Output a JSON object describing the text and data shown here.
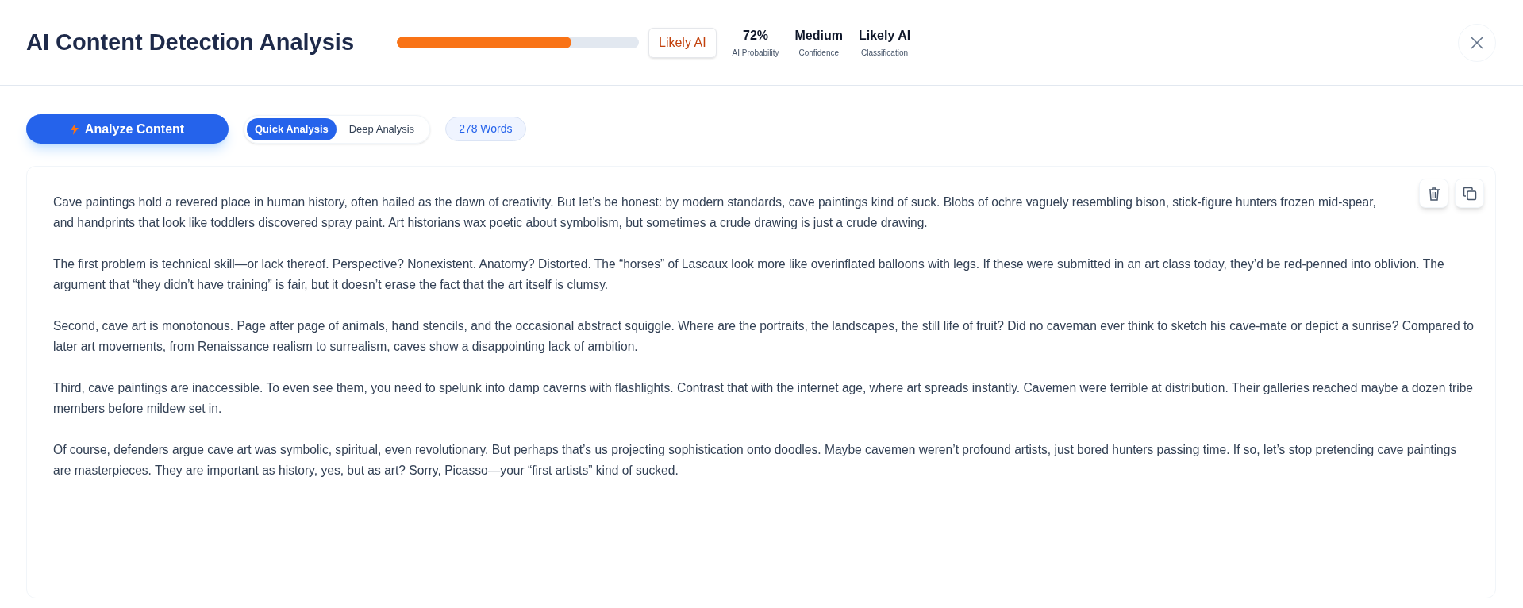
{
  "header": {
    "title": "AI Content Detection Analysis",
    "probability_bar": {
      "level": 0.72
    },
    "verdict_badge": "Likely AI",
    "stats": [
      {
        "value": "72%",
        "label": "AI Probability"
      },
      {
        "value": "Medium",
        "label": "Confidence"
      },
      {
        "value": "Likely AI",
        "label": "Classification"
      }
    ]
  },
  "toolbar": {
    "analyze_button": "Analyze Content",
    "modes": [
      {
        "label": "Quick Analysis",
        "selected": true
      },
      {
        "label": "Deep Analysis",
        "selected": false
      }
    ],
    "word_count": "278 Words"
  },
  "content": {
    "paragraphs": [
      "Cave paintings hold a revered place in human history, often hailed as the dawn of creativity. But let’s be honest: by modern standards, cave paintings kind of suck. Blobs of ochre vaguely resembling bison, stick-figure hunters frozen mid-spear, and handprints that look like toddlers discovered spray paint. Art historians wax poetic about symbolism, but sometimes a crude drawing is just a crude drawing.",
      "The first problem is technical skill—or lack thereof. Perspective? Nonexistent. Anatomy? Distorted. The “horses” of Lascaux look more like overinflated balloons with legs. If these were submitted in an art class today, they’d be red-penned into oblivion. The argument that “they didn’t have training” is fair, but it doesn’t erase the fact that the art itself is clumsy.",
      "Second, cave art is monotonous. Page after page of animals, hand stencils, and the occasional abstract squiggle. Where are the portraits, the landscapes, the still life of fruit? Did no caveman ever think to sketch his cave-mate or depict a sunrise? Compared to later art movements, from Renaissance realism to surrealism, caves show a disappointing lack of ambition.",
      "Third, cave paintings are inaccessible. To even see them, you need to spelunk into damp caverns with flashlights. Contrast that with the internet age, where art spreads instantly. Cavemen were terrible at distribution. Their galleries reached maybe a dozen tribe members before mildew set in.",
      "Of course, defenders argue cave art was symbolic, spiritual, even revolutionary. But perhaps that’s us projecting sophistication onto doodles. Maybe cavemen weren’t profound artists, just bored hunters passing time. If so, let’s stop pretending cave paintings are masterpieces. They are important as history, yes, but as art? Sorry, Picasso—your “first artists” kind of sucked."
    ]
  }
}
